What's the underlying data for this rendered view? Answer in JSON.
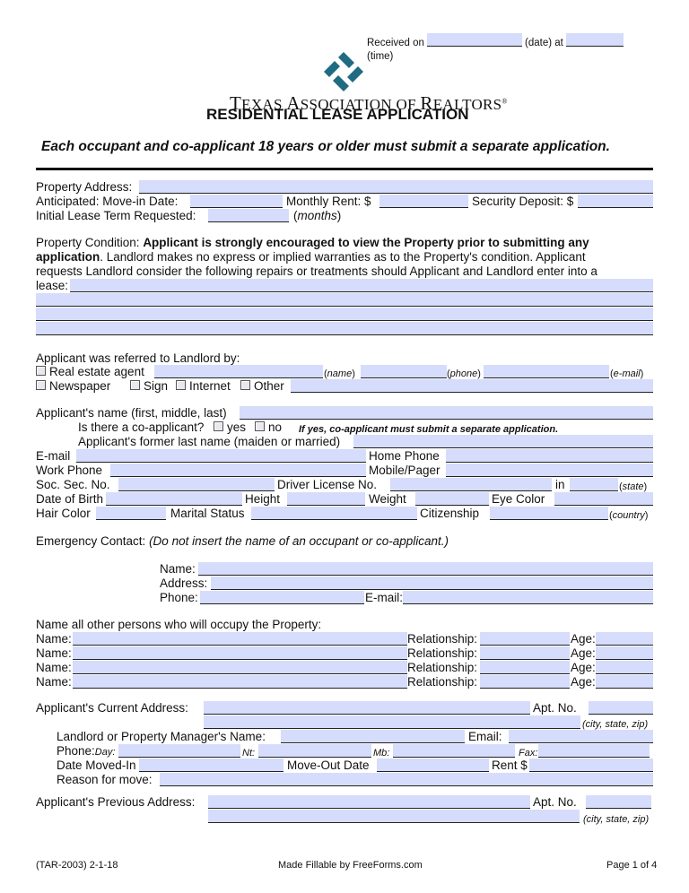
{
  "header": {
    "received_on_label": "Received on",
    "date_label": "(date) at",
    "time_label": "(time)",
    "org_name_prefix_T": "T",
    "org_name_1": "EXAS ",
    "org_name_prefix_A": "A",
    "org_name_2": "SSOCIATION OF ",
    "org_name_prefix_R": "R",
    "org_name_3": "EALTORS",
    "registered_mark": "®",
    "title": "RESIDENTIAL LEASE APPLICATION",
    "notice": "Each occupant and co-applicant 18 years or older must submit a separate application."
  },
  "property": {
    "address_label": "Property Address:",
    "anticipated_label": "Anticipated:  Move-in Date:",
    "monthly_rent_label": "Monthly Rent: $",
    "security_deposit_label": "Security Deposit: $",
    "lease_term_label": "Initial Lease Term Requested:",
    "months_label": "months",
    "condition_label": "Property Condition: ",
    "condition_bold_1": "Applicant is strongly encouraged to view the Property prior to submitting any",
    "condition_bold_2": "application",
    "condition_text_2": ". Landlord makes no express or implied warranties as to the Property's condition. Applicant",
    "condition_text_3": "requests Landlord consider the following repairs or treatments should Applicant and Landlord enter into a",
    "lease_label": "lease:"
  },
  "referral": {
    "heading": "Applicant was referred to Landlord by:",
    "real_estate_agent": "Real estate agent",
    "name_hint": "name",
    "phone_hint": "phone",
    "email_hint": "e-mail",
    "newspaper": "Newspaper",
    "sign": "Sign",
    "internet": "Internet",
    "other": "Other"
  },
  "applicant": {
    "name_label": "Applicant's name (first, middle, last)",
    "coapplicant_label": "Is there a co-applicant?",
    "yes": "yes",
    "no": "no",
    "coapplicant_note": "If yes, co-applicant must submit a separate application.",
    "former_name_label": "Applicant's former last name (maiden or married)",
    "email_label": "E-mail",
    "home_phone_label": "Home Phone",
    "work_phone_label": "Work Phone",
    "mobile_label": "Mobile/Pager",
    "ssn_label": "Soc. Sec. No.",
    "dl_label": "Driver License No.",
    "in_label": "in",
    "state_hint": "state",
    "dob_label": "Date of Birth",
    "height_label": "Height",
    "weight_label": "Weight",
    "eye_label": "Eye Color",
    "hair_label": "Hair Color",
    "marital_label": "Marital Status",
    "citizenship_label": "Citizenship",
    "country_hint": "country"
  },
  "emergency": {
    "heading": "Emergency Contact: ",
    "note": "(Do not insert the name of an occupant or co-applicant.)",
    "name_label": "Name:",
    "address_label": "Address:",
    "phone_label": "Phone:",
    "email_label": "E-mail:"
  },
  "occupants": {
    "heading": "Name all other persons who will occupy the Property:",
    "rows": [
      {
        "name_label": "Name:",
        "relationship_label": "Relationship:",
        "age_label": "Age:"
      },
      {
        "name_label": "Name:",
        "relationship_label": "Relationship:",
        "age_label": "Age:"
      },
      {
        "name_label": "Name:",
        "relationship_label": "Relationship:",
        "age_label": "Age:"
      },
      {
        "name_label": "Name:",
        "relationship_label": "Relationship:",
        "age_label": "Age:"
      }
    ]
  },
  "current_address": {
    "label": "Applicant's Current Address:",
    "apt_label": "Apt. No.",
    "city_hint": "(city, state, zip)",
    "landlord_label": "Landlord or Property Manager's Name:",
    "email_label": "Email:",
    "phone_label": "Phone:",
    "day_label": "Day:",
    "nt_label": "Nt:",
    "mb_label": "Mb:",
    "fax_label": "Fax:",
    "moved_in_label": "Date Moved-In",
    "move_out_label": "Move-Out Date",
    "rent_label": "Rent $",
    "reason_label": "Reason for move:"
  },
  "previous_address": {
    "label": "Applicant's Previous Address:",
    "apt_label": "Apt. No.",
    "city_hint": "(city, state, zip)"
  },
  "footer": {
    "form_id": "(TAR-2003) 2-1-18",
    "made_fillable": "Made Fillable by FreeForms.com",
    "page": "Page 1 of 4"
  },
  "colors": {
    "field_fill": "#d6dcfb",
    "logo": "#1f6b82"
  }
}
